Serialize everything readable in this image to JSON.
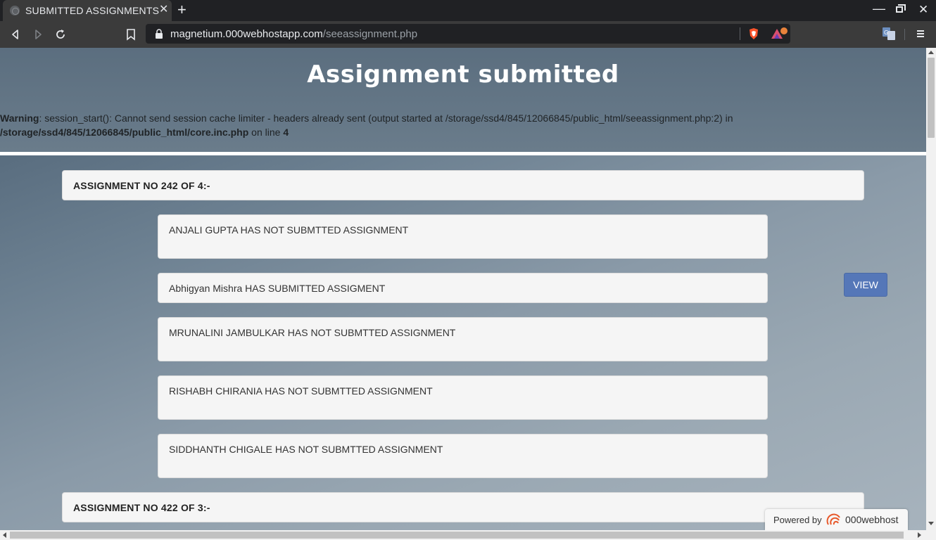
{
  "browser": {
    "tab_title": "SUBMITTED ASSIGNMENTS",
    "tab_close": "✕",
    "new_tab": "+",
    "url_host": "magnetium.000webhostapp.com",
    "url_path": "/seeassignment.php",
    "win_min": "—",
    "win_close": "✕"
  },
  "page": {
    "title": "Assignment submitted",
    "warning": {
      "label": "Warning",
      "text1": ": session_start(): Cannot send session cache limiter - headers already sent (output started at /storage/ssd4/845/12066845/public_html/seeassignment.php:2) in",
      "file": "/storage/ssd4/845/12066845/public_html/core.inc.php",
      "text2": " on line ",
      "line": "4"
    },
    "assignments": [
      {
        "header": "ASSIGNMENT NO 242 OF 4:-",
        "students": [
          "ANJALI GUPTA HAS NOT SUBMTTED ASSIGNMENT",
          "Abhigyan Mishra HAS SUBMITTED ASSIGMENT",
          "MRUNALINI JAMBULKAR HAS NOT SUBMTTED ASSIGNMENT",
          "RISHABH CHIRANIA HAS NOT SUBMTTED ASSIGNMENT",
          "SIDDHANTH CHIGALE HAS NOT SUBMTTED ASSIGNMENT"
        ]
      },
      {
        "header": "ASSIGNMENT NO 422 OF 3:-",
        "students": []
      }
    ],
    "view_button": "VIEW",
    "powered_by": "Powered by",
    "powered_brand": "000webhost"
  }
}
